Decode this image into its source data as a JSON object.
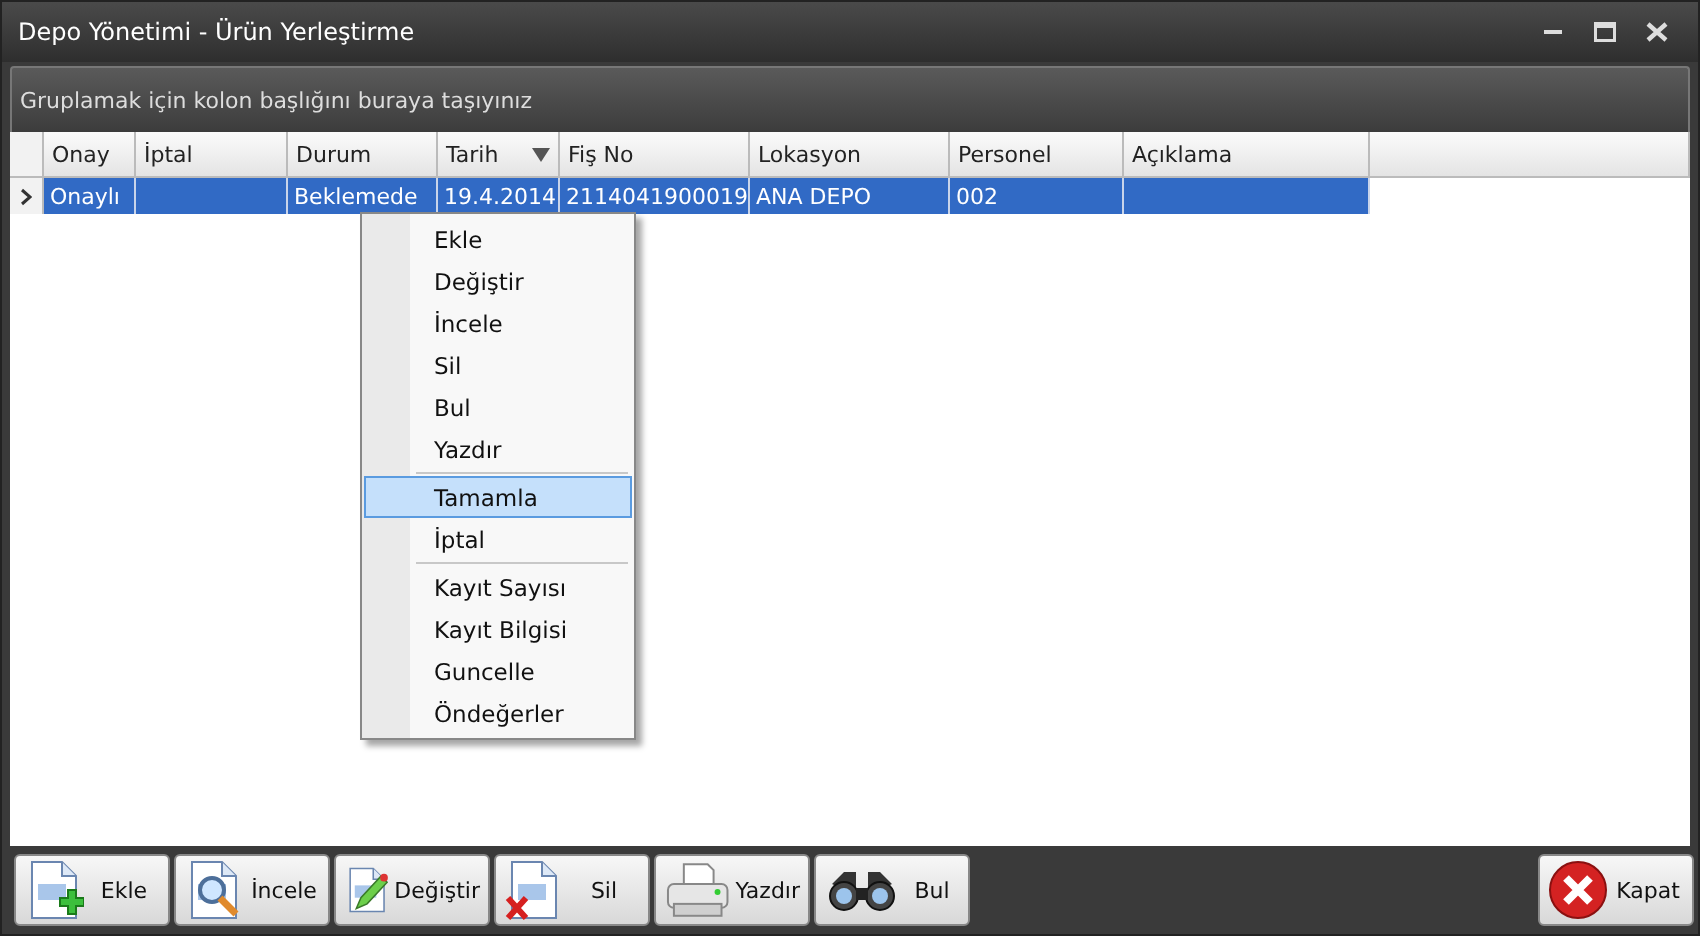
{
  "window": {
    "title": "Depo Yönetimi - Ürün Yerleştirme"
  },
  "group_panel": {
    "hint": "Gruplamak için kolon başlığını buraya taşıyınız"
  },
  "table": {
    "columns": [
      {
        "label": "Onay",
        "sorted": false
      },
      {
        "label": "İptal",
        "sorted": false
      },
      {
        "label": "Durum",
        "sorted": false
      },
      {
        "label": "Tarih",
        "sorted": true
      },
      {
        "label": "Fiş No",
        "sorted": false
      },
      {
        "label": "Lokasyon",
        "sorted": false
      },
      {
        "label": "Personel",
        "sorted": false
      },
      {
        "label": "Açıklama",
        "sorted": false
      }
    ],
    "rows": [
      {
        "selected": true,
        "cells": [
          "Onaylı",
          "",
          "Beklemede",
          "19.4.2014",
          "2114041900019",
          "ANA DEPO",
          "002",
          ""
        ]
      }
    ]
  },
  "context_menu": [
    {
      "label": "Ekle",
      "selected": false,
      "separator_after": false
    },
    {
      "label": "Değiştir",
      "selected": false,
      "separator_after": false
    },
    {
      "label": "İncele",
      "selected": false,
      "separator_after": false
    },
    {
      "label": "Sil",
      "selected": false,
      "separator_after": false
    },
    {
      "label": "Bul",
      "selected": false,
      "separator_after": false
    },
    {
      "label": "Yazdır",
      "selected": false,
      "separator_after": true
    },
    {
      "label": "Tamamla",
      "selected": true,
      "separator_after": false
    },
    {
      "label": "İptal",
      "selected": false,
      "separator_after": true
    },
    {
      "label": "Kayıt Sayısı",
      "selected": false,
      "separator_after": false
    },
    {
      "label": "Kayıt Bilgisi",
      "selected": false,
      "separator_after": false
    },
    {
      "label": "Guncelle",
      "selected": false,
      "separator_after": false
    },
    {
      "label": "Öndeğerler",
      "selected": false,
      "separator_after": false
    }
  ],
  "toolbar": [
    {
      "label": "Ekle",
      "kind": "add"
    },
    {
      "label": "İncele",
      "kind": "inspect"
    },
    {
      "label": "Değiştir",
      "kind": "edit"
    },
    {
      "label": "Sil",
      "kind": "delete"
    },
    {
      "label": "Yazdır",
      "kind": "print"
    },
    {
      "label": "Bul",
      "kind": "find"
    }
  ],
  "close_button": {
    "label": "Kapat"
  }
}
